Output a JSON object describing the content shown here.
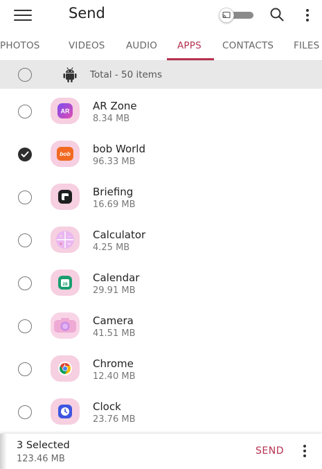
{
  "header": {
    "title": "Send",
    "menu_icon": "hamburger-icon",
    "cast_icon": "cast-icon",
    "search_icon": "search-icon",
    "more_icon": "more-vert-icon"
  },
  "tabs": [
    {
      "label": "PHOTOS",
      "active": false
    },
    {
      "label": "VIDEOS",
      "active": false
    },
    {
      "label": "AUDIO",
      "active": false
    },
    {
      "label": "APPS",
      "active": true
    },
    {
      "label": "CONTACTS",
      "active": false
    },
    {
      "label": "FILES",
      "active": false
    }
  ],
  "total": {
    "label": "Total - 50 items",
    "icon": "android-icon",
    "checked": false
  },
  "apps": [
    {
      "name": "AR Zone",
      "size": "8.34 MB",
      "checked": false,
      "icon": "ar-zone-icon",
      "icon_text": "AR"
    },
    {
      "name": "bob World",
      "size": "96.33 MB",
      "checked": true,
      "icon": "bob-world-icon",
      "icon_text": "bob"
    },
    {
      "name": "Briefing",
      "size": "16.69 MB",
      "checked": false,
      "icon": "briefing-icon"
    },
    {
      "name": "Calculator",
      "size": "4.25 MB",
      "checked": false,
      "icon": "calculator-icon"
    },
    {
      "name": "Calendar",
      "size": "29.91 MB",
      "checked": false,
      "icon": "calendar-icon",
      "icon_text": "28"
    },
    {
      "name": "Camera",
      "size": "41.51 MB",
      "checked": false,
      "icon": "camera-icon"
    },
    {
      "name": "Chrome",
      "size": "12.40 MB",
      "checked": false,
      "icon": "chrome-icon"
    },
    {
      "name": "Clock",
      "size": "23.76 MB",
      "checked": false,
      "icon": "clock-icon"
    }
  ],
  "footer": {
    "selected_label": "3 Selected",
    "selected_size": "123.46 MB",
    "send_label": "SEND",
    "more_icon": "more-vert-icon"
  },
  "colors": {
    "accent": "#b5314f",
    "icon_bg": "#f6cfe0",
    "total_bar_bg": "#e8e8e8"
  }
}
